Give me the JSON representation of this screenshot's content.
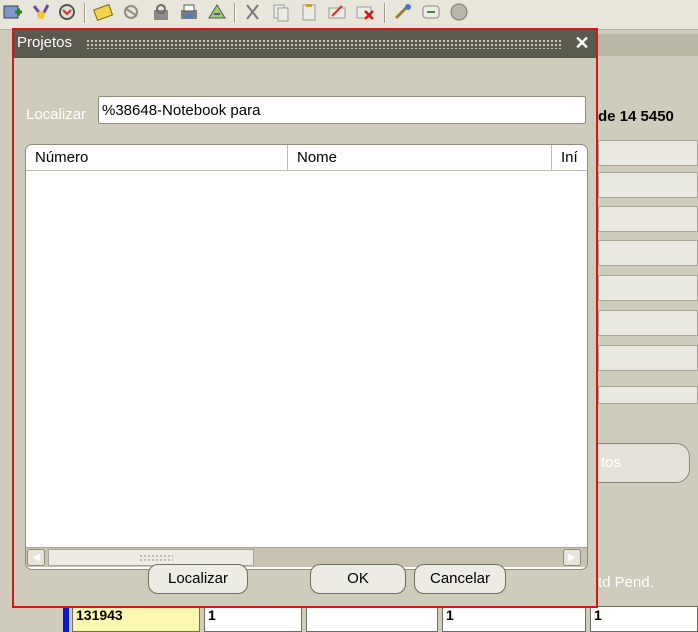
{
  "toolbar": {
    "icons": [
      "new-record-icon",
      "clear-icon",
      "refresh-icon",
      "edit-icon",
      "attachment-icon",
      "lock-icon",
      "print-icon",
      "navigate-icon",
      "cut-icon",
      "copy-icon",
      "paste-icon",
      "edit-field-icon",
      "delete-icon",
      "zoom-icon",
      "translate-icon",
      "help-icon"
    ]
  },
  "background": {
    "header_text": "de 14 5450",
    "button_text": "tos",
    "qtd_label": "td Pend.",
    "row": {
      "cells": [
        "131943",
        "1",
        "",
        "1",
        "1"
      ]
    }
  },
  "dialog": {
    "title": "Projetos",
    "close_glyph": "✕",
    "find_label": "Localizar",
    "find_value": "%38648-Notebook para",
    "columns": [
      "Número",
      "Nome",
      "Iní"
    ],
    "rows": [],
    "buttons": {
      "find": "Localizar",
      "ok": "OK",
      "cancel": "Cancelar"
    }
  },
  "colors": {
    "dialog_border": "#d21818",
    "titlebar": "#5b5a4f",
    "panel": "#cfccbc",
    "highlight_cell": "#fbf6b0",
    "row_marker": "#0a1ad0"
  }
}
